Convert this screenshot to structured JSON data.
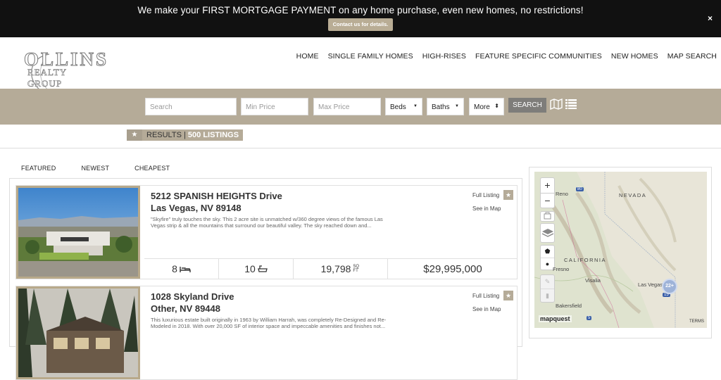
{
  "promo": {
    "message": "We make your FIRST MORTGAGE PAYMENT on any home purchase, even new homes, no restrictions!",
    "cta": "Contact us for details.",
    "close": "×"
  },
  "logo": {
    "main": "OLLINS",
    "sub": "REALTY GROUP"
  },
  "nav": [
    "HOME",
    "SINGLE FAMILY HOMES",
    "HIGH-RISES",
    "FEATURE SPECIFIC COMMUNITIES",
    "NEW HOMES",
    "MAP SEARCH"
  ],
  "search": {
    "search_placeholder": "Search",
    "min_price_placeholder": "Min Price",
    "max_price_placeholder": "Max Price",
    "beds": "Beds",
    "baths": "Baths",
    "more": "More",
    "button": "SEARCH"
  },
  "results": {
    "label": "RESULTS",
    "separator": "|",
    "count": "500 LISTINGS"
  },
  "sort_tabs": [
    "FEATURED",
    "NEWEST",
    "CHEAPEST"
  ],
  "listings": [
    {
      "address1": "5212 SPANISH HEIGHTS Drive",
      "address2": "Las Vegas, NV 89148",
      "description": "\"Skyfire\" truly touches the sky. This 2 acre site is unmatched w/360 degree views of the famous Las Vegas strip & all the mountains that surround our beautiful valley. The sky reached down and...",
      "full_listing": "Full Listing",
      "see_in_map": "See in Map",
      "beds": "8",
      "baths": "10",
      "sqft": "19,798",
      "sqft_unit": "SQ FT",
      "price": "$29,995,000"
    },
    {
      "address1": "1028 Skyland Drive",
      "address2": "Other, NV 89448",
      "description": "This luxurious estate built originally in 1963 by William Harrah, was completely Re-Designed and Re-Modeled in 2018. With over 20,000 SF of interior space and impeccable amenities and finishes not...",
      "full_listing": "Full Listing",
      "see_in_map": "See in Map"
    }
  ],
  "map": {
    "zoom_in": "+",
    "zoom_out": "−",
    "labels": [
      "Reno",
      "NEVADA",
      "CALIFORNIA",
      "Fresno",
      "Visalia",
      "Bakersfield",
      "Las Vegas"
    ],
    "shields": [
      "80",
      "5",
      "15"
    ],
    "cluster": "22+",
    "brand": "mapquest",
    "terms": "TERMS"
  }
}
